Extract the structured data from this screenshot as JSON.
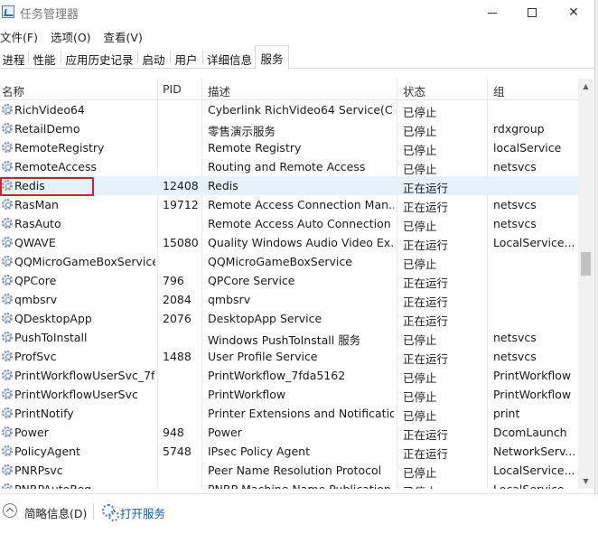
{
  "window": {
    "title": "任务管理器",
    "minimize": "—",
    "maximize": "□",
    "close": "✕"
  },
  "menu": [
    "文件(F)",
    "选项(O)",
    "查看(V)"
  ],
  "tabs": [
    "进程",
    "性能",
    "应用历史记录",
    "启动",
    "用户",
    "详细信息",
    "服务"
  ],
  "active_tab": "服务",
  "columns": [
    "名称",
    "PID",
    "描述",
    "状态",
    "组"
  ],
  "selected_service": "Redis",
  "rows": [
    {
      "name": "RichVideo64",
      "pid": "",
      "desc": "Cyberlink RichVideo64 Service(C...",
      "status": "已停止",
      "group": ""
    },
    {
      "name": "RetailDemo",
      "pid": "",
      "desc": "零售演示服务",
      "status": "已停止",
      "group": "rdxgroup"
    },
    {
      "name": "RemoteRegistry",
      "pid": "",
      "desc": "Remote Registry",
      "status": "已停止",
      "group": "localService"
    },
    {
      "name": "RemoteAccess",
      "pid": "",
      "desc": "Routing and Remote Access",
      "status": "已停止",
      "group": "netsvcs"
    },
    {
      "name": "Redis",
      "pid": "12408",
      "desc": "Redis",
      "status": "正在运行",
      "group": ""
    },
    {
      "name": "RasMan",
      "pid": "19712",
      "desc": "Remote Access Connection Man...",
      "status": "正在运行",
      "group": "netsvcs"
    },
    {
      "name": "RasAuto",
      "pid": "",
      "desc": "Remote Access Auto Connection ...",
      "status": "已停止",
      "group": "netsvcs"
    },
    {
      "name": "QWAVE",
      "pid": "15080",
      "desc": "Quality Windows Audio Video Ex...",
      "status": "正在运行",
      "group": "LocalService..."
    },
    {
      "name": "QQMicroGameBoxService",
      "pid": "",
      "desc": "QQMicroGameBoxService",
      "status": "已停止",
      "group": ""
    },
    {
      "name": "QPCore",
      "pid": "796",
      "desc": "QPCore Service",
      "status": "正在运行",
      "group": ""
    },
    {
      "name": "qmbsrv",
      "pid": "2084",
      "desc": "qmbsrv",
      "status": "正在运行",
      "group": ""
    },
    {
      "name": "QDesktopApp",
      "pid": "2076",
      "desc": "DesktopApp Service",
      "status": "正在运行",
      "group": ""
    },
    {
      "name": "PushToInstall",
      "pid": "",
      "desc": "Windows PushToInstall 服务",
      "status": "已停止",
      "group": "netsvcs"
    },
    {
      "name": "ProfSvc",
      "pid": "1488",
      "desc": "User Profile Service",
      "status": "正在运行",
      "group": "netsvcs"
    },
    {
      "name": "PrintWorkflowUserSvc_7f...",
      "pid": "",
      "desc": "PrintWorkflow_7fda5162",
      "status": "已停止",
      "group": "PrintWorkflow"
    },
    {
      "name": "PrintWorkflowUserSvc",
      "pid": "",
      "desc": "PrintWorkflow",
      "status": "已停止",
      "group": "PrintWorkflow"
    },
    {
      "name": "PrintNotify",
      "pid": "",
      "desc": "Printer Extensions and Notificatio...",
      "status": "已停止",
      "group": "print"
    },
    {
      "name": "Power",
      "pid": "948",
      "desc": "Power",
      "status": "正在运行",
      "group": "DcomLaunch"
    },
    {
      "name": "PolicyAgent",
      "pid": "5748",
      "desc": "IPsec Policy Agent",
      "status": "正在运行",
      "group": "NetworkServ..."
    },
    {
      "name": "PNRPsvc",
      "pid": "",
      "desc": "Peer Name Resolution Protocol",
      "status": "已停止",
      "group": "LocalService..."
    },
    {
      "name": "PNRPAutoReg",
      "pid": "",
      "desc": "PNRP Machine Name Publication ...",
      "status": "已停止",
      "group": "LocalService..."
    }
  ],
  "footer": {
    "fewer_details": "简略信息(D)",
    "open_services": "打开服务"
  }
}
